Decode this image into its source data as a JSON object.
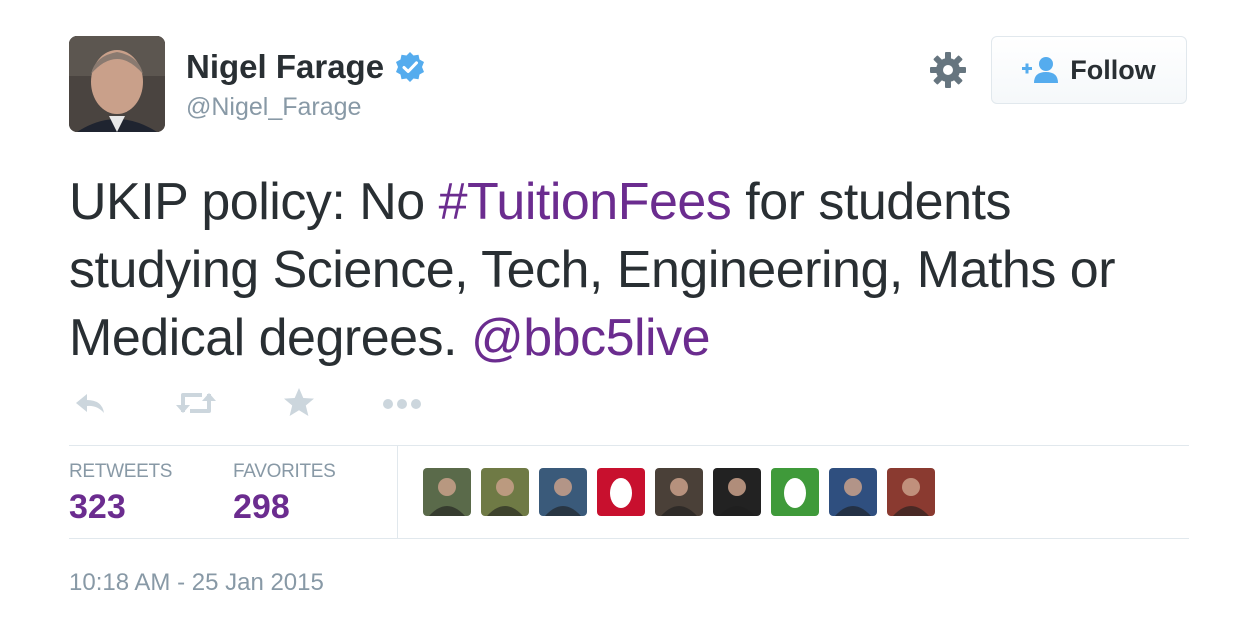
{
  "author": {
    "name": "Nigel Farage",
    "handle": "@Nigel_Farage",
    "verified": true
  },
  "follow_button": {
    "label": "Follow"
  },
  "tweet": {
    "segments": [
      {
        "text": "UKIP policy: No ",
        "type": "text"
      },
      {
        "text": "#TuitionFees",
        "type": "hashtag"
      },
      {
        "text": " for students studying Science, Tech, Engineering, Maths or Medical degrees. ",
        "type": "text"
      },
      {
        "text": "@bbc5live",
        "type": "mention"
      }
    ]
  },
  "actions": [
    "reply-icon",
    "retweet-icon",
    "favorite-icon",
    "more-icon"
  ],
  "stats": {
    "retweets_label": "RETWEETS",
    "retweets": "323",
    "favorites_label": "FAVORITES",
    "favorites": "298"
  },
  "faces": [
    {
      "kind": "photo",
      "bg": "#5a6a4a"
    },
    {
      "kind": "photo",
      "bg": "#6f7a45"
    },
    {
      "kind": "photo",
      "bg": "#3a5a7a"
    },
    {
      "kind": "egg",
      "bg": "#c8102e"
    },
    {
      "kind": "photo",
      "bg": "#4a4038"
    },
    {
      "kind": "photo",
      "bg": "#222222"
    },
    {
      "kind": "egg",
      "bg": "#3f9a3a"
    },
    {
      "kind": "photo",
      "bg": "#2f4f7f"
    },
    {
      "kind": "photo",
      "bg": "#8a3a30"
    }
  ],
  "timestamp": "10:18 AM - 25 Jan 2015",
  "colors": {
    "link": "#6b2c8f",
    "muted": "#8899a6",
    "verified": "#55acee"
  }
}
